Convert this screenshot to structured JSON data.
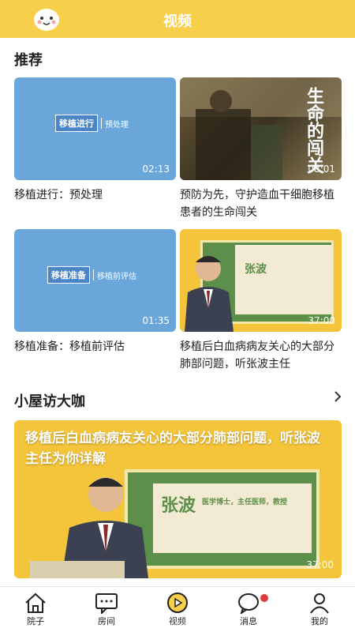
{
  "header": {
    "title": "视频"
  },
  "sections": {
    "recommend": "推荐",
    "interview": "小屋访大咖"
  },
  "cards": [
    {
      "thumb_label": "移植进行",
      "thumb_sub": "预处理",
      "duration": "02:13",
      "title": "移植进行：预处理"
    },
    {
      "poem": "生命的闯关",
      "duration": "08:01",
      "title": "预防为先，守护造血干细胞移植患者的生命闯关"
    },
    {
      "thumb_label": "移植准备",
      "thumb_sub": "移植前评估",
      "duration": "01:35",
      "title": "移植准备：移植前评估"
    },
    {
      "doctor_name": "张波",
      "duration": "37:00",
      "title": "移植后白血病病友关心的大部分肺部问题，听张波主任"
    }
  ],
  "banner": {
    "text": "移植后白血病病友关心的大部分肺部问题，听张波主任为你详解",
    "doctor_name": "张波",
    "doctor_title": "医学博士，主任医师，教授",
    "duration": "37:00"
  },
  "tabs": [
    {
      "label": "院子",
      "icon": "house-icon"
    },
    {
      "label": "房间",
      "icon": "chat-icon"
    },
    {
      "label": "视频",
      "icon": "play-icon",
      "active": true
    },
    {
      "label": "消息",
      "icon": "message-icon"
    },
    {
      "label": "我的",
      "icon": "user-icon"
    }
  ],
  "colors": {
    "accent": "#f7cf4a",
    "thumb_blue": "#6aa6d9",
    "thumb_yellow": "#f4c43a",
    "badge": "#e23a3a"
  }
}
